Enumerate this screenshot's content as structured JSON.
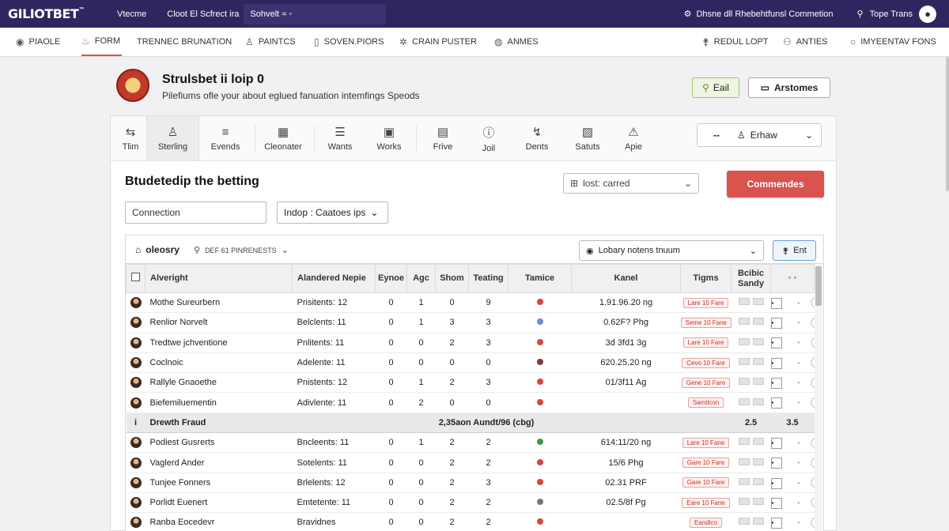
{
  "topbar": {
    "logo": "GILIOTBET",
    "logo_mark": "™",
    "link_home": "Vtecme",
    "search_prefix": "Cloot El Scfrect ira",
    "search_value": "Sohvelt ≈ ◦",
    "connection": "Dhsne dll Rhebehtfunsl Commetion",
    "user": "Tope Trans"
  },
  "nav": {
    "items": [
      {
        "label": "PIAOLE",
        "icon": "eye-icon"
      },
      {
        "label": "FORM",
        "icon": "fire-icon",
        "active": true
      },
      {
        "label": "TRENNEC BRUNATION",
        "icon": ""
      },
      {
        "label": "PAINTCS",
        "icon": "user-icon"
      },
      {
        "label": "SOVEN.PIORS",
        "icon": "document-icon"
      },
      {
        "label": "CRAIN PUSTER",
        "icon": "star-icon"
      },
      {
        "label": "ANMES",
        "icon": "globe-icon"
      },
      {
        "label": "REDUL LOPT",
        "icon": "walk-icon"
      },
      {
        "label": "ANTIES",
        "icon": "people-icon"
      },
      {
        "label": "IMYEENTAV FONS",
        "icon": "circle-icon"
      }
    ]
  },
  "page": {
    "title": "Strulsbet ii loip 0",
    "subtitle": "Pilefiums ofle your about eglued fanuation intemfings Speods",
    "edit_button": "Eail",
    "arst_button": "Arstomes"
  },
  "toolbar": {
    "tools": [
      {
        "label": "Tlim",
        "icon": "arrows-icon"
      },
      {
        "label": "Sterling",
        "icon": "person-icon",
        "active": true
      },
      {
        "label": "Evends",
        "icon": "list-icon"
      },
      {
        "label": "Cleonater",
        "icon": "calendar-icon"
      },
      {
        "label": "Wants",
        "icon": "lines-icon"
      },
      {
        "label": "Works",
        "icon": "briefcase-icon"
      },
      {
        "label": "Frive",
        "icon": "tray-icon"
      },
      {
        "label": "Joil",
        "icon": "info-icon"
      },
      {
        "label": "Dents",
        "icon": "pin-icon"
      },
      {
        "label": "Satuts",
        "icon": "image-icon"
      },
      {
        "label": "Apie",
        "icon": "warning-icon"
      }
    ],
    "view_prefix": "--",
    "view_value": "Erhaw"
  },
  "section": {
    "title": "Btudetedip the betting",
    "select_value": "lost: carred",
    "primary_button": "Commendes",
    "input_value": "Connection",
    "filter_value": "Indop : Caatoes ips"
  },
  "panel": {
    "title": "oleosry",
    "filter_label": "DEF 61 PINRENESTS",
    "dropdown_value": "Lobary notens tnuum",
    "button": "Ent"
  },
  "table": {
    "headers": [
      "",
      "Alveright",
      "Alandered Nepie",
      "Eynoe",
      "Agc",
      "Shom",
      "Teating",
      "Tamice",
      "Kanel",
      "Tigms",
      "Bcibic Sandy",
      "• •"
    ],
    "rows": [
      {
        "name": "Mothe Sureurbern",
        "rank": "Prisitents: 12",
        "c1": "0",
        "c2": "1",
        "c3": "0",
        "c4": "9",
        "dot": "#d9453f",
        "time": "1.91.96.20 ng",
        "tag": "Lare 10 Fare"
      },
      {
        "name": "Renlior Norvelt",
        "rank": "Belclents: 11",
        "c1": "0",
        "c2": "1",
        "c3": "3",
        "c4": "3",
        "dot": "#6a8cc7",
        "time": "0.62F? Phg",
        "tag": "Seme 10 Fane"
      },
      {
        "name": "Tredtwe jchventione",
        "rank": "Pnlitents: 11",
        "c1": "0",
        "c2": "0",
        "c3": "2",
        "c4": "3",
        "dot": "#d9453f",
        "time": "3d 3fd1 3g",
        "tag": "Lare 10 Fare"
      },
      {
        "name": "Coclnoic",
        "rank": "Adelente: 11",
        "c1": "0",
        "c2": "0",
        "c3": "0",
        "c4": "0",
        "dot": "#7a3b3b",
        "time": "620.25.20 ng",
        "tag": "Cevo 10 Fare"
      },
      {
        "name": "Rallyle Gnaoethe",
        "rank": "Pnistents: 12",
        "c1": "0",
        "c2": "1",
        "c3": "2",
        "c4": "3",
        "dot": "#d9453f",
        "time": "01/3f11 Ag",
        "tag": "Gene 10 Fare"
      },
      {
        "name": "Biefemiluementin",
        "rank": "Adivlente: 11",
        "c1": "0",
        "c2": "2",
        "c3": "0",
        "c4": "0",
        "dot": "#d9453f",
        "time": "",
        "tag": "Samtlcon"
      }
    ],
    "group_row": {
      "marker": "i",
      "label": "Drewth Fraud",
      "middle": "2,35aon Aundt/96 (cbg)",
      "v1": "2.5",
      "v2": "3.5"
    },
    "rows2": [
      {
        "name": "Podiest Gusrerts",
        "rank": "Bncleents: 11",
        "c1": "0",
        "c2": "1",
        "c3": "2",
        "c4": "2",
        "dot": "#3a9a4a",
        "time": "614:11/20 ng",
        "tag": "Lare 10 Fane"
      },
      {
        "name": "Vaglerd Ander",
        "rank": "Sotelents: 11",
        "c1": "0",
        "c2": "0",
        "c3": "2",
        "c4": "2",
        "dot": "#d9453f",
        "time": "15/6 Phg",
        "tag": "Gare 10 Fare"
      },
      {
        "name": "Tunjee Fonners",
        "rank": "Brlelents: 12",
        "c1": "0",
        "c2": "0",
        "c3": "2",
        "c4": "3",
        "dot": "#d9453f",
        "time": "02.31 PRF",
        "tag": "Gare 10 Fare"
      },
      {
        "name": "Porlidt Euenert",
        "rank": "Emtetente: 11",
        "c1": "0",
        "c2": "0",
        "c3": "2",
        "c4": "2",
        "dot": "#777777",
        "time": "02.5/8f Pg",
        "tag": "Eare 10 Fane"
      },
      {
        "name": "Ranba Eocedevr",
        "rank": "Bravidnes",
        "c1": "0",
        "c2": "0",
        "c3": "2",
        "c4": "2",
        "dot": "#d9453f",
        "time": "",
        "tag": "Eandlco"
      }
    ]
  }
}
